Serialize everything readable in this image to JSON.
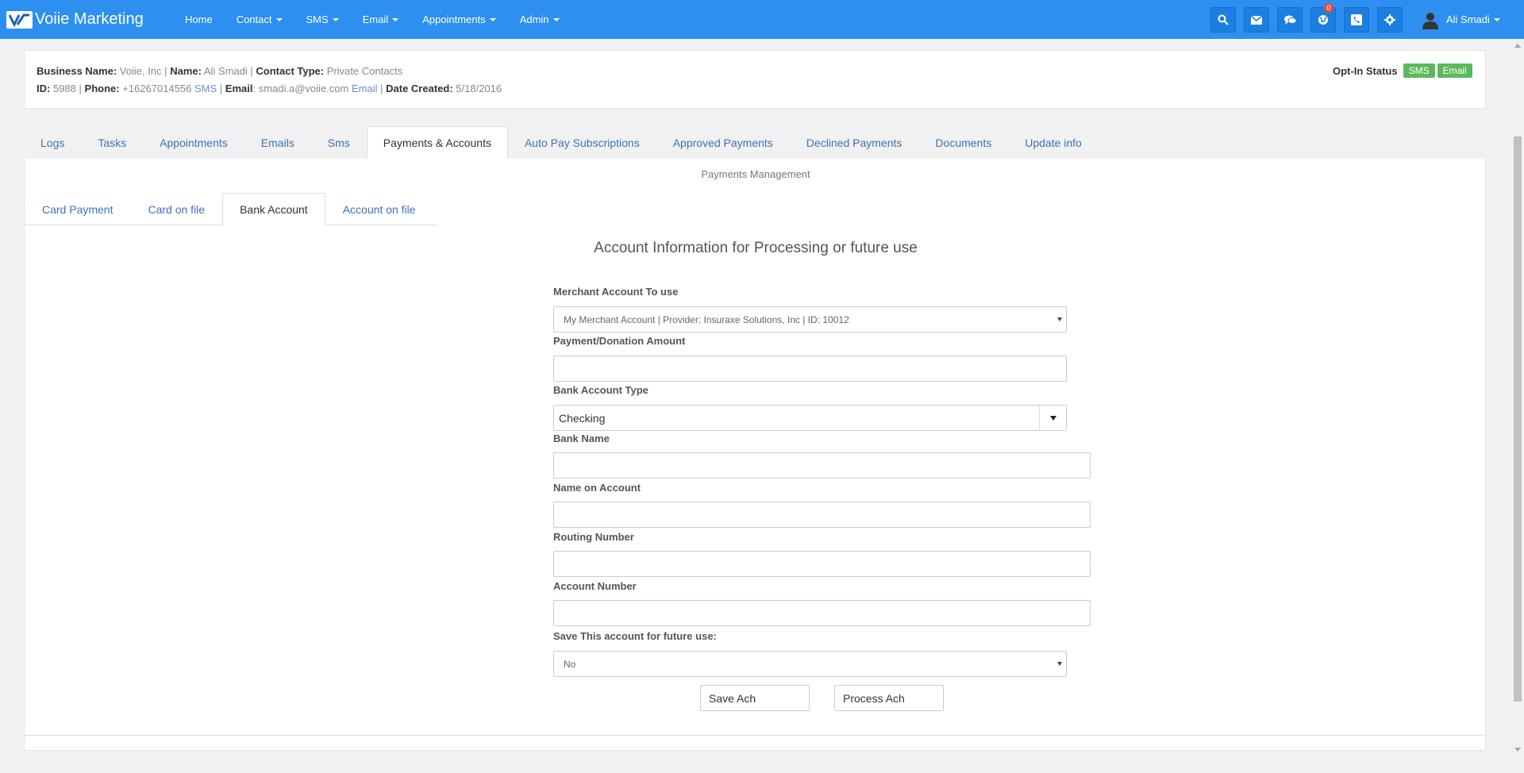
{
  "navbar": {
    "brand": "Voiie Marketing",
    "menu": [
      {
        "label": "Home",
        "dropdown": false
      },
      {
        "label": "Contact",
        "dropdown": true
      },
      {
        "label": "SMS",
        "dropdown": true
      },
      {
        "label": "Email",
        "dropdown": true
      },
      {
        "label": "Appointments",
        "dropdown": true
      },
      {
        "label": "Admin",
        "dropdown": true
      }
    ],
    "notifications_badge": "0",
    "user_name": "Ali Smadi"
  },
  "contact_info": {
    "business_name_label": "Business Name:",
    "business_name": "Voiie, Inc",
    "name_label": "Name:",
    "name": "Ali Smadi",
    "contact_type_label": "Contact Type:",
    "contact_type": "Private Contacts",
    "id_label": "ID:",
    "id": "5988",
    "phone_label": "Phone:",
    "phone": "+16267014556",
    "phone_link": "SMS",
    "email_label": "Email",
    "email": "smadi.a@voiie.com",
    "email_link": "Email",
    "date_created_label": "Date Created:",
    "date_created": "5/18/2016",
    "optin_label": "Opt-In Status",
    "optin_sms": "SMS",
    "optin_email": "Email"
  },
  "main_tabs": [
    "Logs",
    "Tasks",
    "Appointments",
    "Emails",
    "Sms",
    "Payments & Accounts",
    "Auto Pay Subscriptions",
    "Approved Payments",
    "Declined Payments",
    "Documents",
    "Update info"
  ],
  "payments": {
    "title": "Payments Management",
    "sub_tabs": [
      "Card Payment",
      "Card on file",
      "Bank Account",
      "Account on file"
    ],
    "form_heading": "Account Information for Processing or future use",
    "merchant_label": "Merchant Account To use",
    "merchant_value": "My Merchant Account | Provider: Insuraxe Solutions, Inc | ID: 10012",
    "amount_label": "Payment/Donation Amount",
    "amount_value": "",
    "bank_type_label": "Bank Account Type",
    "bank_type_value": "Checking",
    "bank_name_label": "Bank Name",
    "name_on_account_label": "Name on Account",
    "routing_label": "Routing Number",
    "account_number_label": "Account Number",
    "save_future_label": "Save This account for future use:",
    "save_future_value": "No",
    "save_button": "Save Ach",
    "process_button": "Process Ach"
  }
}
